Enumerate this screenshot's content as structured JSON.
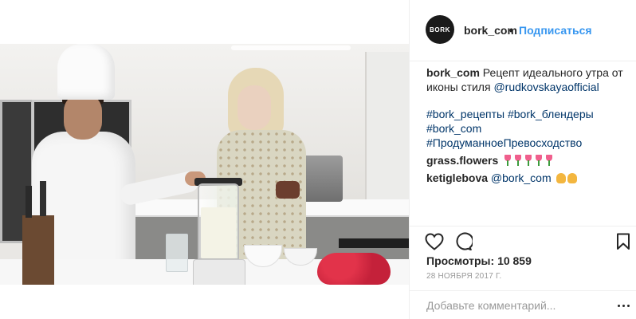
{
  "post": {
    "video_alt": "Chef and woman with blender in a kitchen"
  },
  "header": {
    "avatar_text": "BORK",
    "username": "bork_com",
    "dot": "•",
    "follow_label": "Подписаться"
  },
  "caption": {
    "username": "bork_com",
    "text": " Рецепт идеального утра от иконы стиля ",
    "mention": "@rudkovskayaofficial",
    "hashtags": [
      "#bork_рецепты",
      "#bork_блендеры",
      "#bork_com",
      "#ПродуманноеПревосходство"
    ]
  },
  "comments": [
    {
      "username": "grass.flowers",
      "emoji_count": 5
    },
    {
      "username": "ketiglebova",
      "mention": "@bork_com"
    }
  ],
  "actions": {
    "like_icon": "heart-icon",
    "comment_icon": "speech-bubble-icon",
    "save_icon": "bookmark-icon"
  },
  "stats": {
    "views_label": "Просмотры:",
    "views_count": "10 859",
    "date": "28 НОЯБРЯ 2017 Г."
  },
  "add_comment": {
    "placeholder": "Добавьте комментарий...",
    "more_icon": "more-options-icon"
  },
  "colors": {
    "link_blue": "#3897f0",
    "mention_navy": "#003569",
    "text": "#262626",
    "muted": "#999999"
  }
}
